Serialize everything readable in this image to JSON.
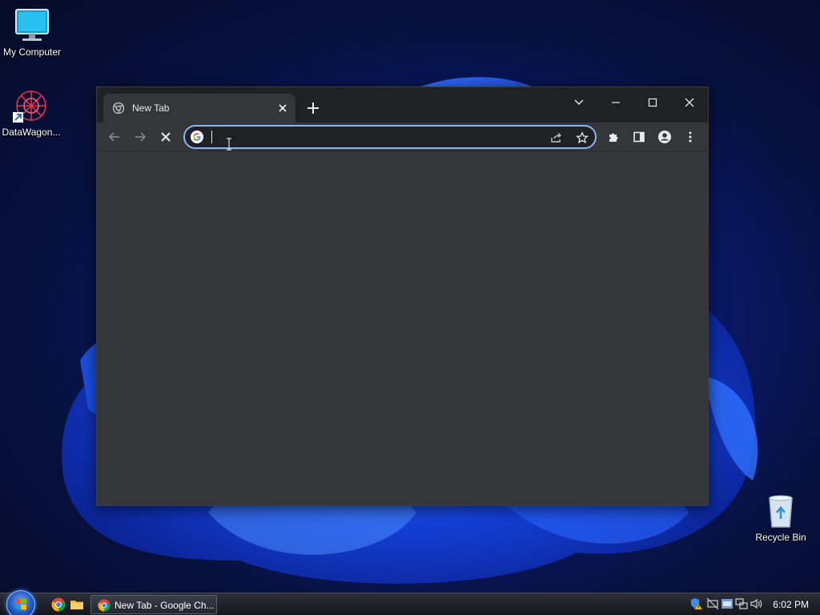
{
  "desktop": {
    "icons": [
      {
        "label": "My Computer"
      },
      {
        "label": "DataWagon..."
      },
      {
        "label": "Recycle Bin"
      }
    ]
  },
  "browser": {
    "tab": {
      "title": "New Tab"
    },
    "address_bar": {
      "value": "",
      "placeholder": ""
    },
    "accent_color": "#8ab4f8",
    "icons": [
      "back-arrow-icon",
      "forward-arrow-icon",
      "stop-icon",
      "google-icon",
      "share-icon",
      "star-icon",
      "extensions-icon",
      "side-panel-icon",
      "profile-icon",
      "more-menu-icon"
    ]
  },
  "taskbar": {
    "task_label": "New Tab - Google Ch...",
    "clock": "6:02 PM"
  }
}
